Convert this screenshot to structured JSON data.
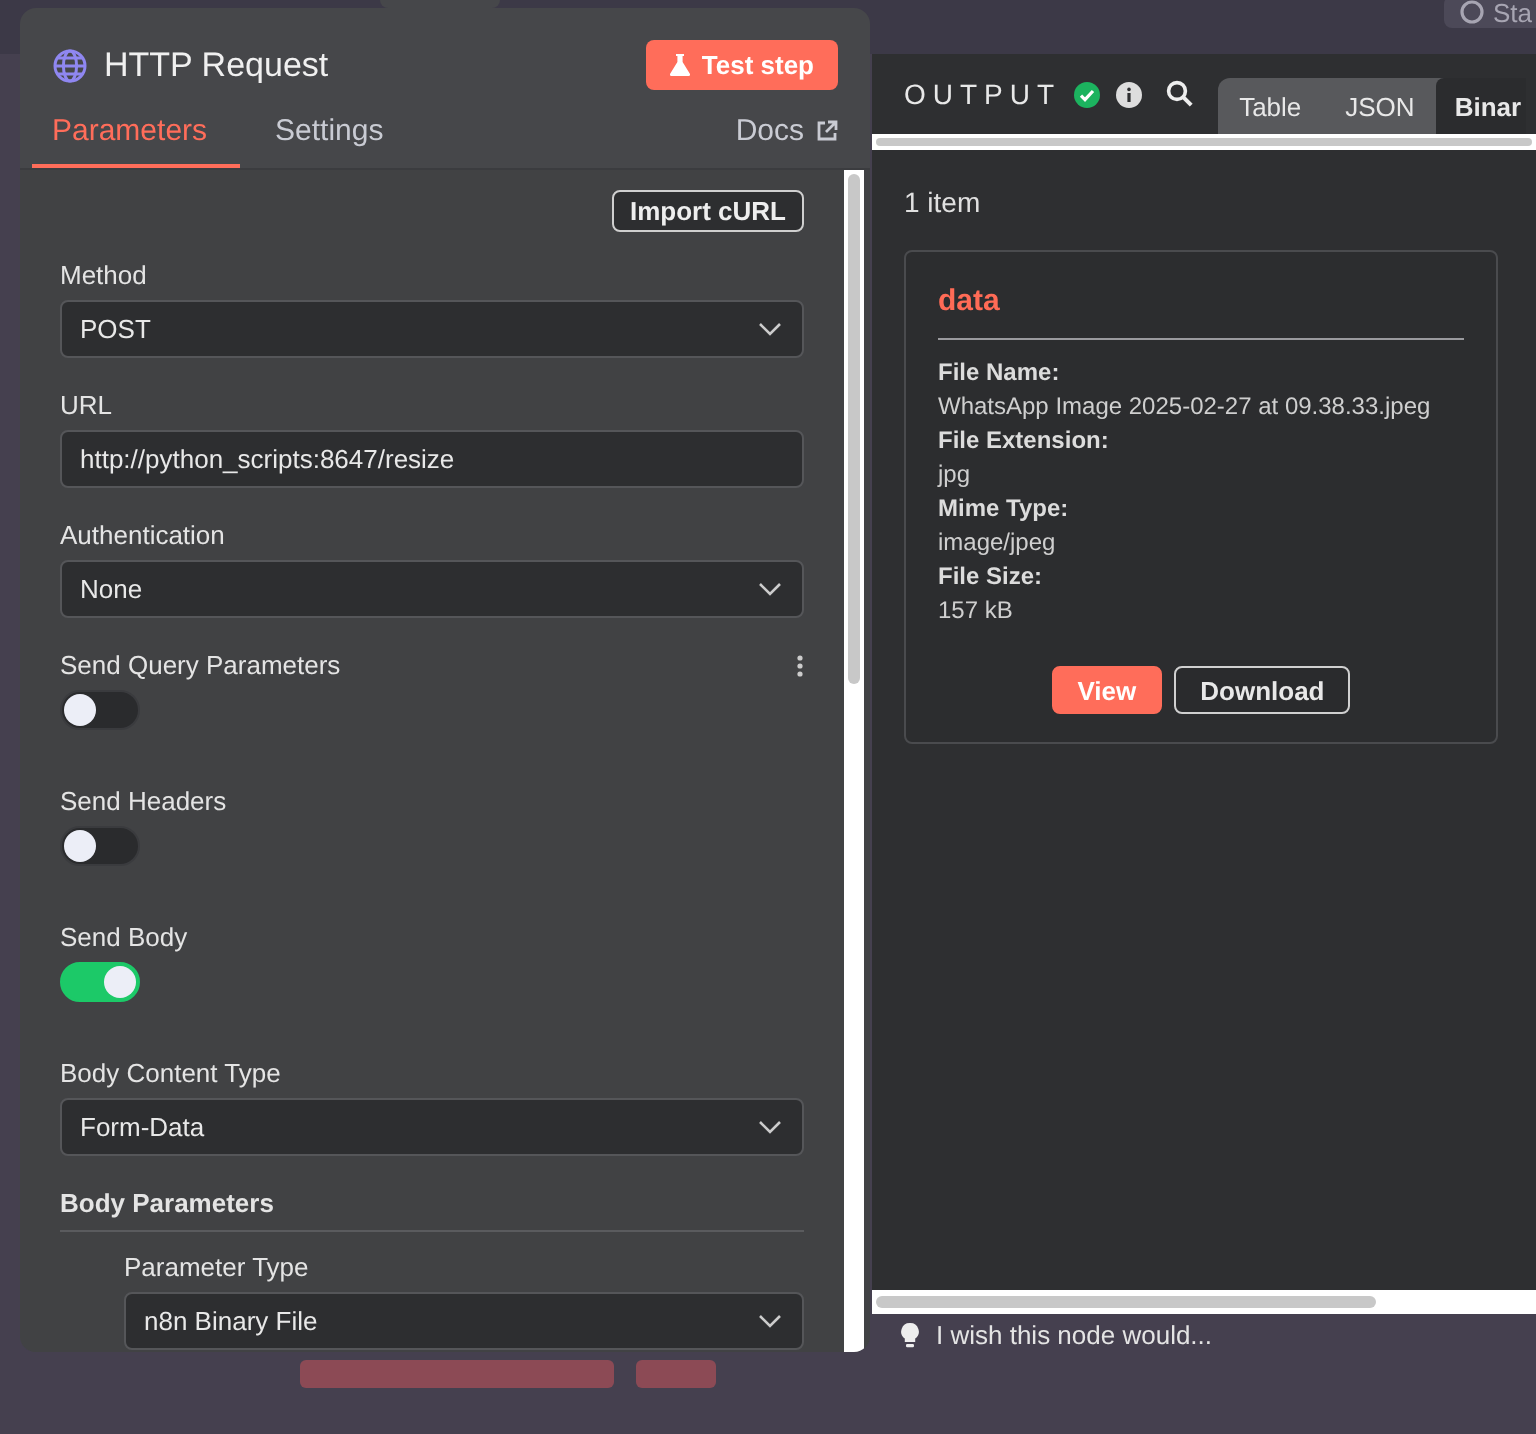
{
  "top_bar": {
    "star_button": "Sta"
  },
  "node_panel": {
    "title": "HTTP Request",
    "test_button": "Test step",
    "tabs": [
      {
        "label": "Parameters",
        "selected": true
      },
      {
        "label": "Settings",
        "selected": false
      }
    ],
    "docs_link": "Docs",
    "import_button": "Import cURL",
    "fields": [
      {
        "kind": "select",
        "label": "Method",
        "value": "POST"
      },
      {
        "kind": "input",
        "label": "URL",
        "value": "http://python_scripts:8647/resize"
      },
      {
        "kind": "select",
        "label": "Authentication",
        "value": "None"
      },
      {
        "kind": "toggle",
        "label": "Send Query Parameters",
        "on": false,
        "options_menu": true
      },
      {
        "kind": "toggle",
        "label": "Send Headers",
        "on": false,
        "options_menu": false
      },
      {
        "kind": "toggle",
        "label": "Send Body",
        "on": true,
        "options_menu": false
      },
      {
        "kind": "select",
        "label": "Body Content Type",
        "value": "Form-Data"
      },
      {
        "kind": "section",
        "label": "Body Parameters",
        "children": [
          {
            "kind": "select",
            "label": "Parameter Type",
            "value": "n8n Binary File"
          }
        ]
      }
    ]
  },
  "output": {
    "title": "OUTPUT",
    "tabs": [
      {
        "label": "Table",
        "selected": false
      },
      {
        "label": "JSON",
        "selected": false
      },
      {
        "label": "Binar",
        "selected": true
      }
    ],
    "count": "1 item",
    "card": {
      "title": "data",
      "fields": [
        {
          "label": "File Name:",
          "value": "WhatsApp Image 2025-02-27 at 09.38.33.jpeg"
        },
        {
          "label": "File Extension:",
          "value": "jpg"
        },
        {
          "label": "Mime Type:",
          "value": "image/jpeg"
        },
        {
          "label": "File Size:",
          "value": "157 kB"
        }
      ],
      "buttons": [
        {
          "label": "View",
          "kind": "primary"
        },
        {
          "label": "Download",
          "kind": "secondary"
        }
      ]
    },
    "feedback": "I wish this node would..."
  }
}
